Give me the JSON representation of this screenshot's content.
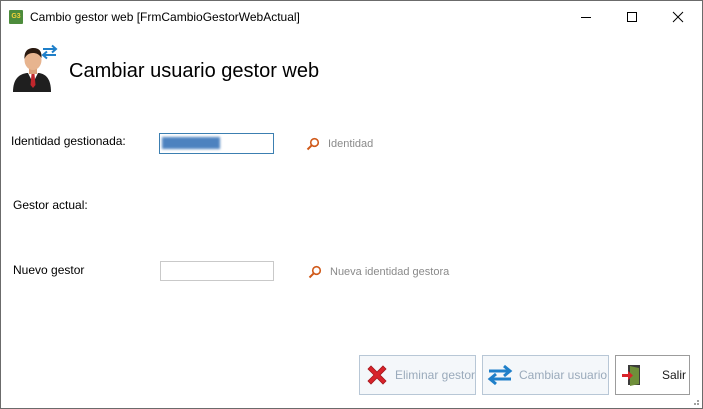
{
  "window": {
    "app_icon_text": "G3",
    "title": "Cambio gestor web [FrmCambioGestorWebActual]"
  },
  "header": {
    "title": "Cambiar usuario gestor web",
    "icon": "user-swap-icon"
  },
  "form": {
    "identity_label": "Identidad gestionada:",
    "identity_value_obscured": true,
    "identity_search_label": "Identidad",
    "current_manager_label": "Gestor actual:",
    "current_manager_value": "",
    "new_manager_label": "Nuevo gestor",
    "new_manager_value": "",
    "new_manager_search_label": "Nueva identidad gestora"
  },
  "buttons": {
    "delete_label": "Eliminar gestor",
    "change_label": "Cambiar usuario",
    "exit_label": "Salir"
  },
  "colors": {
    "accent": "#3c7fb1",
    "disabled_text": "#9aaabb",
    "delete_red": "#d8232a",
    "swap_blue": "#1f7fc9"
  }
}
